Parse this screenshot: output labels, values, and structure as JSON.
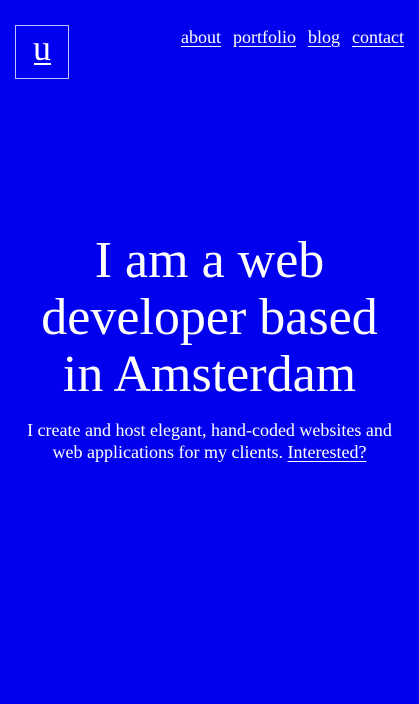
{
  "brand": {
    "logo_letter": "u"
  },
  "nav": {
    "items": [
      {
        "label": "about"
      },
      {
        "label": "portfolio"
      },
      {
        "label": "blog"
      },
      {
        "label": "contact"
      }
    ]
  },
  "hero": {
    "headline": "I am a web developer based in Amsterdam",
    "intro": "I create and host elegant, hand-coded websites and web applications for my clients.",
    "cta_link": "Interested?"
  },
  "colors": {
    "background": "#0000ee",
    "text": "#ffffff"
  }
}
